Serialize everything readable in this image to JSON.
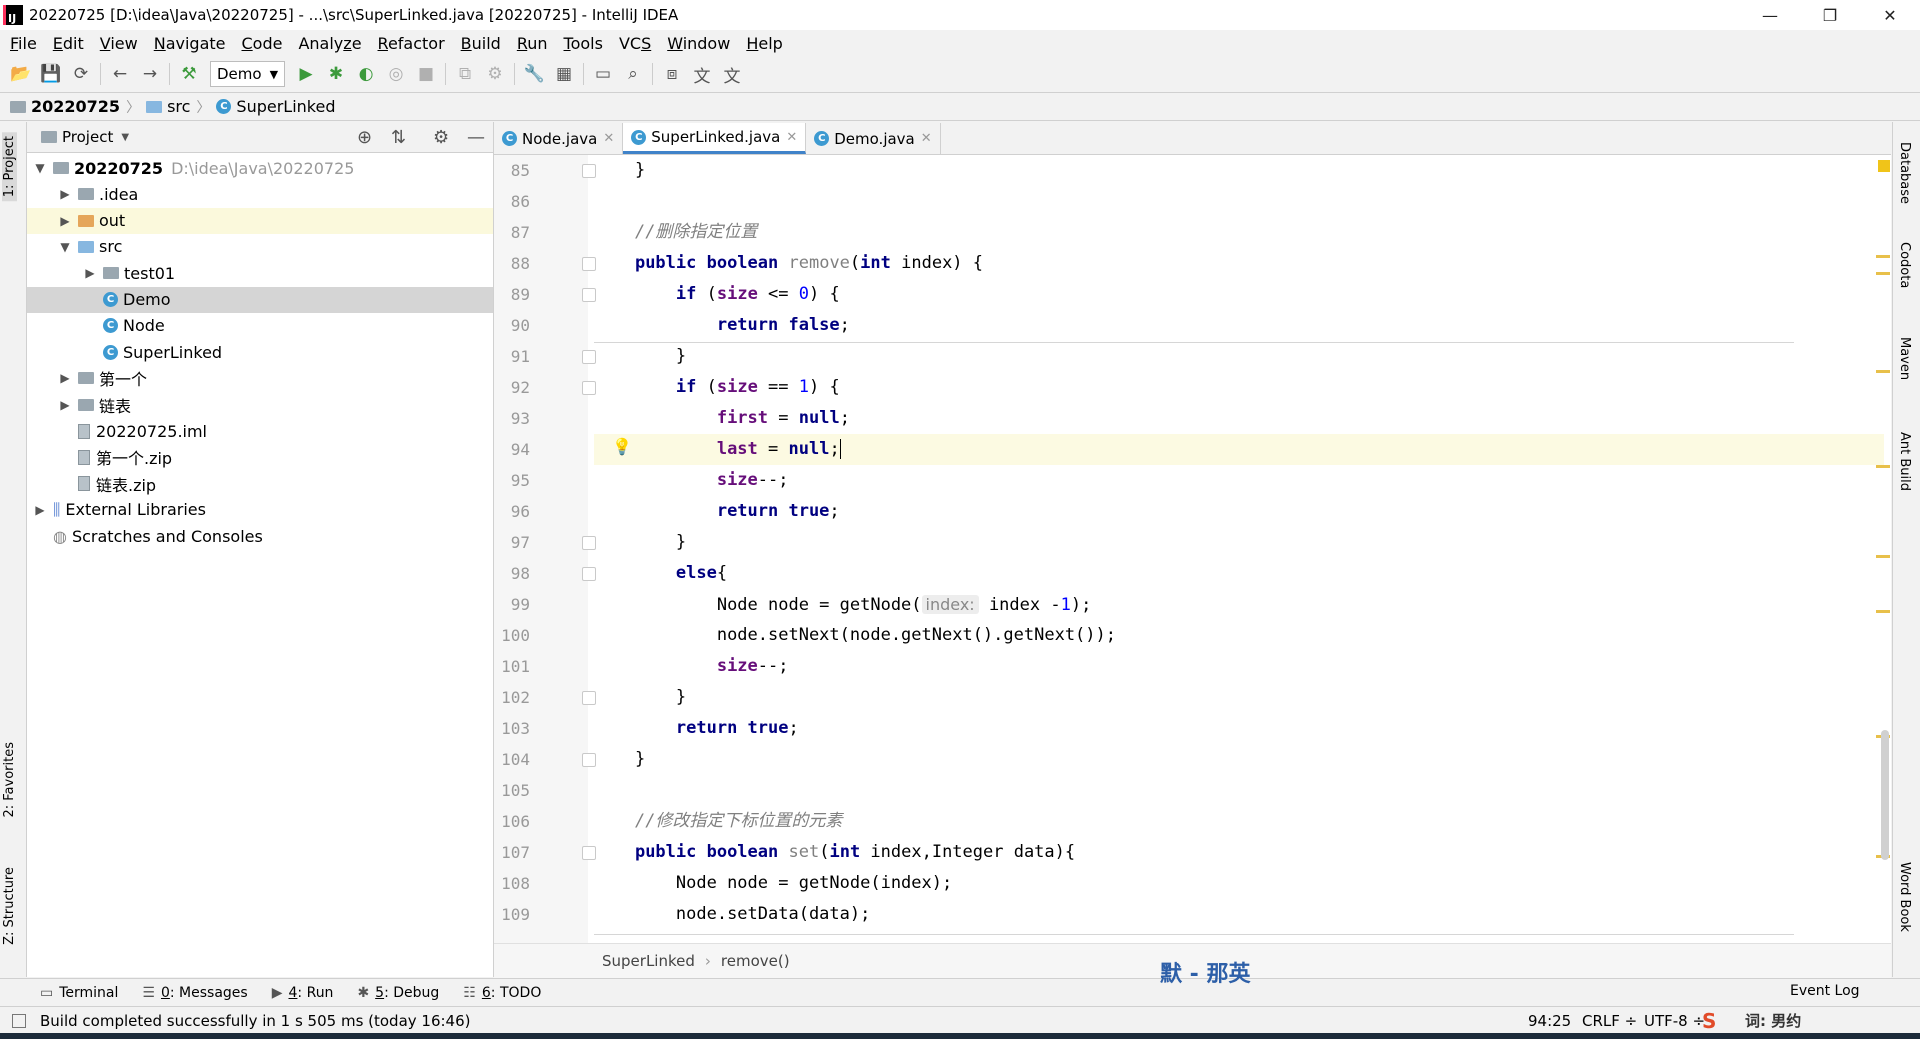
{
  "titlebar": {
    "title": "20220725 [D:\\idea\\Java\\20220725] - ...\\src\\SuperLinked.java [20220725] - IntelliJ IDEA",
    "minimize": "—",
    "restore": "❐",
    "close": "✕"
  },
  "menu": [
    "File",
    "Edit",
    "View",
    "Navigate",
    "Code",
    "Analyze",
    "Refactor",
    "Build",
    "Run",
    "Tools",
    "VCS",
    "Window",
    "Help"
  ],
  "menu_underline": [
    "F",
    "E",
    "V",
    "N",
    "C",
    "z",
    "R",
    "B",
    "R",
    "T",
    "S",
    "W",
    "H"
  ],
  "toolbar": {
    "run_config": "Demo"
  },
  "navbar": {
    "crumbs": [
      "20220725",
      "src",
      "SuperLinked"
    ]
  },
  "left_stripe": {
    "project": "1: Project",
    "favorites": "2: Favorites",
    "structure": "Z: Structure"
  },
  "project_panel": {
    "title": "Project",
    "tree": [
      {
        "label": "20220725",
        "hint": "D:\\idea\\Java\\20220725"
      },
      {
        "label": ".idea"
      },
      {
        "label": "out"
      },
      {
        "label": "src"
      },
      {
        "label": "test01"
      },
      {
        "label": "Demo"
      },
      {
        "label": "Node"
      },
      {
        "label": "SuperLinked"
      },
      {
        "label": "第一个"
      },
      {
        "label": "链表"
      },
      {
        "label": "20220725.iml"
      },
      {
        "label": "第一个.zip"
      },
      {
        "label": "链表.zip"
      },
      {
        "label": "External Libraries"
      },
      {
        "label": "Scratches and Consoles"
      }
    ]
  },
  "tabs": [
    "Node.java",
    "SuperLinked.java",
    "Demo.java"
  ],
  "gutter": {
    "lines": [
      "85",
      "86",
      "87",
      "88",
      "89",
      "90",
      "91",
      "92",
      "93",
      "94",
      "95",
      "96",
      "97",
      "98",
      "99",
      "100",
      "101",
      "102",
      "103",
      "104",
      "105",
      "106",
      "107",
      "108",
      "109"
    ]
  },
  "code": {
    "l85": "}",
    "l87": "//删除指定位置",
    "l88_kw": "public boolean",
    "l88_m": "remove",
    "l88_a": "(",
    "l88_kw2": "int",
    "l88_b": " index) {",
    "l89_kw": "if",
    "l89_a": " (",
    "l89_f": "size",
    "l89_b": " <= ",
    "l89_n": "0",
    "l89_c": ") {",
    "l90_kw": "return false",
    "l90_a": ";",
    "l91": "}",
    "l92_kw": "if",
    "l92_a": " (",
    "l92_f": "size",
    "l92_b": " == ",
    "l92_n": "1",
    "l92_c": ") {",
    "l93_f": "first",
    "l93_a": " = ",
    "l93_kw": "null",
    "l93_b": ";",
    "l94_f": "last",
    "l94_a": " = ",
    "l94_kw": "null",
    "l94_b": ";",
    "l95_f": "size",
    "l95_a": "--;",
    "l96_kw": "return true",
    "l96_a": ";",
    "l97": "}",
    "l98_kw": "else",
    "l98_a": "{",
    "l99_a": "Node node = getNode(",
    "l99_hint": "index:",
    "l99_b": " index -",
    "l99_n": "1",
    "l99_c": ");",
    "l100": "node.setNext(node.getNext().getNext());",
    "l101_f": "size",
    "l101_a": "--;",
    "l102": "}",
    "l103_kw": "return true",
    "l103_a": ";",
    "l104": "}",
    "l106": "//修改指定下标位置的元素",
    "l107_kw": "public boolean",
    "l107_m": "set",
    "l107_a": "(",
    "l107_kw2": "int",
    "l107_b": " index,Integer data){",
    "l108": "Node node = getNode(index);",
    "l109": "node.setData(data);"
  },
  "editor_breadcrumb": [
    "SuperLinked",
    "remove()"
  ],
  "right_stripe": [
    "Database",
    "Codota",
    "Maven",
    "Ant Build",
    "Word Book"
  ],
  "bottom_tools": [
    {
      "num": "",
      "label": "Terminal"
    },
    {
      "num": "0",
      "label": ": Messages"
    },
    {
      "num": "4",
      "label": ": Run"
    },
    {
      "num": "5",
      "label": ": Debug"
    },
    {
      "num": "6",
      "label": ": TODO"
    }
  ],
  "event_log": "Event Log",
  "status": {
    "message": "Build completed successfully in 1 s 505 ms (today 16:46)",
    "position": "94:25",
    "line_sep": "CRLF ÷",
    "encoding": "UTF-8 ÷"
  },
  "ime": "默 - 那英",
  "ime_right": "词: 男约"
}
